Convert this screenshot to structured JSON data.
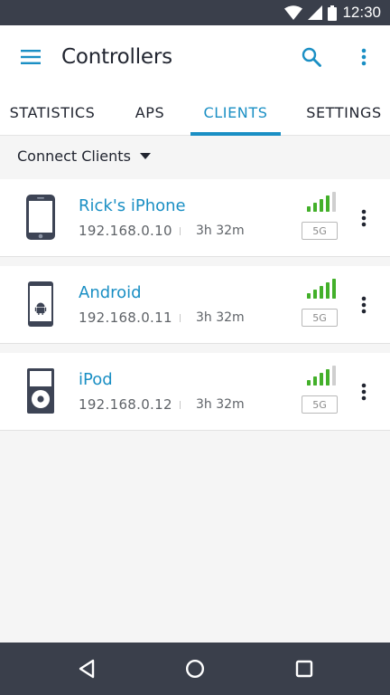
{
  "status_bar": {
    "time": "12:30",
    "icons": [
      "wifi-icon",
      "cell-signal-icon",
      "battery-icon"
    ]
  },
  "app_bar": {
    "title": "Controllers",
    "icons": [
      "menu-icon",
      "search-icon",
      "more-vert-icon"
    ]
  },
  "tabs": [
    {
      "label": "STATISTICS",
      "active": false
    },
    {
      "label": "APS",
      "active": false
    },
    {
      "label": "CLIENTS",
      "active": true
    },
    {
      "label": "SETTINGS",
      "active": false
    }
  ],
  "filter": {
    "label": "Connect Clients"
  },
  "clients": [
    {
      "name": "Rick's iPhone",
      "ip": "192.168.0.10",
      "duration": "3h 32m",
      "band": "5G",
      "device_icon": "iphone-icon",
      "signal_bars": 4
    },
    {
      "name": "Android",
      "ip": "192.168.0.11",
      "duration": "3h 32m",
      "band": "5G",
      "device_icon": "android-phone-icon",
      "signal_bars": 5
    },
    {
      "name": "iPod",
      "ip": "192.168.0.12",
      "duration": "3h 32m",
      "band": "5G",
      "device_icon": "ipod-icon",
      "signal_bars": 4
    }
  ],
  "colors": {
    "accent": "#1a8fc4",
    "signal_on": "#43b02a",
    "signal_off": "#cfcfcf",
    "system_bar": "#3a3f4b"
  }
}
